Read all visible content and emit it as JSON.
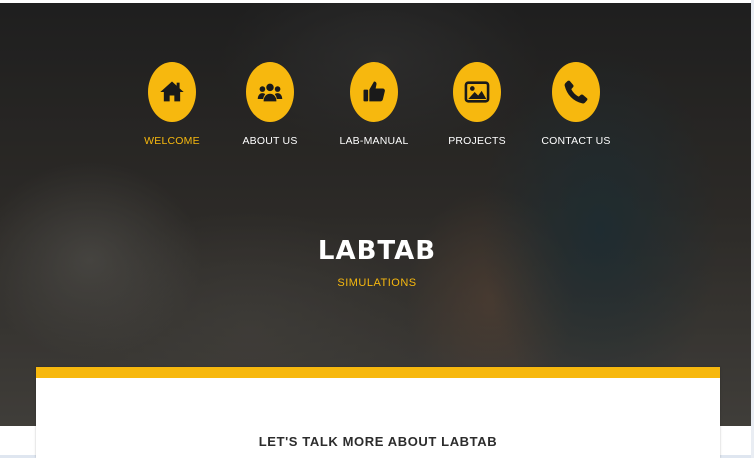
{
  "nav": {
    "items": [
      {
        "label": "WELCOME",
        "icon": "home-icon",
        "active": true
      },
      {
        "label": "ABOUT US",
        "icon": "users-icon",
        "active": false
      },
      {
        "label": "LAB-MANUAL",
        "icon": "thumbs-up-icon",
        "active": false
      },
      {
        "label": "PROJECTS",
        "icon": "image-icon",
        "active": false
      },
      {
        "label": "CONTACT US",
        "icon": "phone-icon",
        "active": false
      }
    ]
  },
  "hero": {
    "title": "LABTAB",
    "subtitle": "SIMULATIONS"
  },
  "section": {
    "heading": "LET'S TALK MORE ABOUT LABTAB"
  },
  "colors": {
    "accent": "#f7b80e",
    "text_light": "#ffffff",
    "text_dark": "#2c2c2c"
  }
}
